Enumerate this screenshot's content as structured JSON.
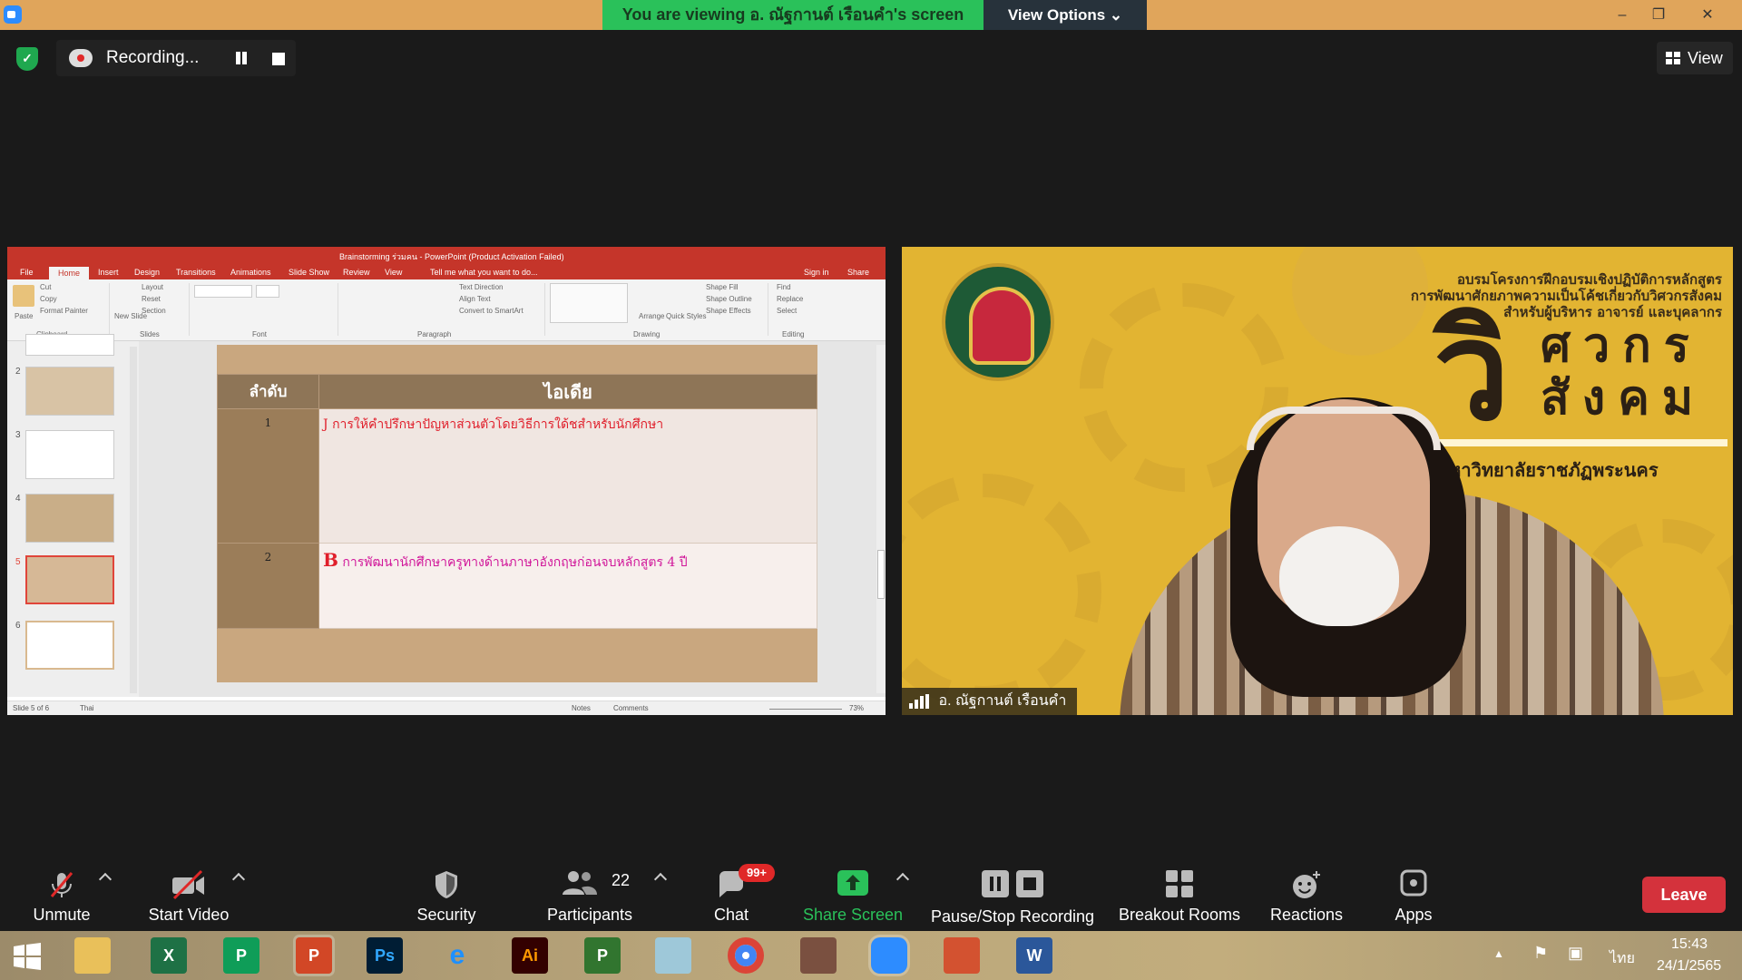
{
  "topbar": {
    "banner": "You are viewing อ. ณัฐกานต์  เรือนคำ's screen",
    "view_options": "View Options ⌄",
    "minimize": "–",
    "restore": "❐",
    "close": "✕"
  },
  "recording": {
    "label": "Recording...",
    "view_label": "View"
  },
  "ppt": {
    "title": "Brainstorming ร่วมคน - PowerPoint (Product Activation Failed)",
    "tabs": [
      "File",
      "Home",
      "Insert",
      "Design",
      "Transitions",
      "Animations",
      "Slide Show",
      "Review",
      "View",
      "Tell me what you want to do...",
      "Sign in",
      "Share"
    ],
    "ribbon": {
      "paste": "Paste",
      "cut": "Cut",
      "copy": "Copy",
      "format_painter": "Format Painter",
      "clipboard": "Clipboard",
      "new_slide": "New Slide",
      "layout": "Layout",
      "reset": "Reset",
      "section": "Section",
      "slides": "Slides",
      "font": "Font",
      "paragraph": "Paragraph",
      "text_direction": "Text Direction",
      "align_text": "Align Text",
      "convert_smartart": "Convert to SmartArt",
      "arrange": "Arrange",
      "quick_styles": "Quick Styles",
      "shape_fill": "Shape Fill",
      "shape_outline": "Shape Outline",
      "shape_effects": "Shape Effects",
      "drawing": "Drawing",
      "find": "Find",
      "replace": "Replace",
      "select": "Select",
      "editing": "Editing"
    },
    "thumb_numbers": [
      "2",
      "3",
      "4",
      "5",
      "6"
    ],
    "table": {
      "col1": "ลำดับ",
      "col2": "ไอเดีย",
      "rows": [
        {
          "num": "1",
          "prefix": "J",
          "idea": "การให้คำปรึกษาปัญหาส่วนตัวโดยวิธีการใด้ชสำหรับนักศึกษา"
        },
        {
          "num": "2",
          "prefix": "B",
          "idea": "การพัฒนานักศึกษาครูทางด้านภาษาอังกฤษก่อนจบหลักสูตร 4 ปี"
        }
      ]
    },
    "status": {
      "slide": "Slide 5 of 6",
      "lang": "Thai",
      "notes": "Notes",
      "comments": "Comments",
      "zoom": "73%"
    }
  },
  "video": {
    "line1": "อบรมโครงการฝึกอบรมเชิงปฏิบัติการหลักสูตร",
    "line2": "การพัฒนาศักยภาพความเป็นโค้ชเกี่ยวกับวิศวกรสังคม",
    "line3": "สำหรับผู้บริหาร อาจารย์ และบุคลากร",
    "big_letter": "วิ",
    "big_word1": "ศวกร",
    "big_word2": "สังคม",
    "university": "มหาวิทยาลัยราชภัฏพระนคร",
    "name": "อ. ณัฐกานต์  เรือนคำ"
  },
  "toolbar": {
    "unmute": "Unmute",
    "start_video": "Start Video",
    "security": "Security",
    "participants": "Participants",
    "participants_count": "22",
    "chat": "Chat",
    "chat_badge": "99+",
    "share_screen": "Share Screen",
    "pause_stop": "Pause/Stop Recording",
    "breakout": "Breakout Rooms",
    "reactions": "Reactions",
    "apps": "Apps",
    "leave": "Leave"
  },
  "taskbar": {
    "excel": "X",
    "publisher": "P",
    "powerpoint": "P",
    "photoshop": "Ps",
    "illustrator": "Ai",
    "project": "P",
    "word": "W",
    "ime": "ไทย",
    "time": "15:43",
    "date": "24/1/2565"
  },
  "colors": {
    "zoom_green": "#2ac15a",
    "leave_red": "#d4323c",
    "ppt_red": "#c5352a"
  }
}
